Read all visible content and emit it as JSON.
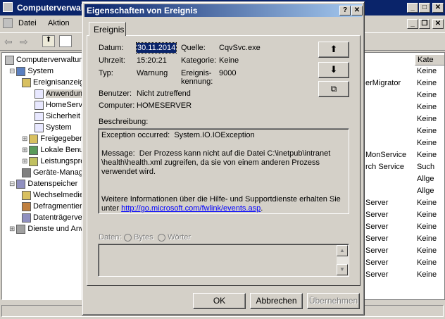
{
  "main": {
    "title": "Computerverwaltung",
    "menu": [
      "Datei",
      "Aktion"
    ],
    "tree": [
      {
        "label": "Computerverwaltung (Lokal)",
        "level": 0
      },
      {
        "label": "System",
        "level": 1
      },
      {
        "label": "Ereignisanzeige",
        "level": 2
      },
      {
        "label": "Anwendung",
        "level": 3
      },
      {
        "label": "HomeServer",
        "level": 3
      },
      {
        "label": "Sicherheit",
        "level": 3
      },
      {
        "label": "System",
        "level": 3
      },
      {
        "label": "Freigegebene Ordner",
        "level": 2
      },
      {
        "label": "Lokale Benutzer",
        "level": 2
      },
      {
        "label": "Leistungsprotokolle",
        "level": 2
      },
      {
        "label": "Geräte-Manager",
        "level": 2
      },
      {
        "label": "Datenspeicher",
        "level": 1
      },
      {
        "label": "Wechselmedien",
        "level": 2
      },
      {
        "label": "Defragmentierung",
        "level": 2
      },
      {
        "label": "Datenträgerverwaltung",
        "level": 2
      },
      {
        "label": "Dienste und Anwendungen",
        "level": 1
      }
    ],
    "list_header": "Kate",
    "list_rows": [
      {
        "left": "",
        "right": "Keine"
      },
      {
        "left": "erMigrator",
        "right": "Keine"
      },
      {
        "left": "",
        "right": "Keine"
      },
      {
        "left": "",
        "right": "Keine"
      },
      {
        "left": "",
        "right": "Keine"
      },
      {
        "left": "",
        "right": "Keine"
      },
      {
        "left": "",
        "right": "Keine"
      },
      {
        "left": "MonService",
        "right": "Keine"
      },
      {
        "left": "rch Service",
        "right": "Such"
      },
      {
        "left": "",
        "right": "Allge"
      },
      {
        "left": "",
        "right": "Allge"
      },
      {
        "left": "Server",
        "right": "Keine"
      },
      {
        "left": "Server",
        "right": "Keine"
      },
      {
        "left": "Server",
        "right": "Keine"
      },
      {
        "left": "Server",
        "right": "Keine"
      },
      {
        "left": "Server",
        "right": "Keine"
      },
      {
        "left": "Server",
        "right": "Keine"
      },
      {
        "left": "Server",
        "right": "Keine"
      }
    ]
  },
  "dialog": {
    "title": "Eigenschaften von Ereignis",
    "tab": "Ereignis",
    "fields": {
      "datum_label": "Datum:",
      "datum_value": "30.11.2014",
      "quelle_label": "Quelle:",
      "quelle_value": "CqvSvc.exe",
      "uhrzeit_label": "Uhrzeit:",
      "uhrzeit_value": "15:20:21",
      "kategorie_label": "Kategorie:",
      "kategorie_value": "Keine",
      "typ_label": "Typ:",
      "typ_value": "Warnung",
      "kennung_label_1": "Ereignis-",
      "kennung_label_2": "kennung:",
      "kennung_value": "9000",
      "benutzer_label": "Benutzer:",
      "benutzer_value": "Nicht zutreffend",
      "computer_label": "Computer:",
      "computer_value": "HOMESERVER"
    },
    "beschreibung_label": "Beschreibung:",
    "description": {
      "line1": "Exception occurred:  System.IO.IOException",
      "line2": "Message:  Der Prozess kann nicht auf die Datei C:\\inetpub\\intranet\n\\health\\health.xml zugreifen, da sie von einem anderen Prozess\nverwendet wird.",
      "line3": "Weitere Informationen über die Hilfe- und Supportdienste erhalten Sie\nunter ",
      "link": "http://go.microsoft.com/fwlink/events.asp",
      "link_suffix": "."
    },
    "daten_label": "Daten:",
    "radio_bytes": "Bytes",
    "radio_woerter": "Wörter",
    "buttons": {
      "ok": "OK",
      "cancel": "Abbrechen",
      "apply": "Übernehmen"
    }
  },
  "colors": {
    "titlebar": "#0a246a",
    "link": "#0000ff",
    "face": "#d4d0c8"
  }
}
